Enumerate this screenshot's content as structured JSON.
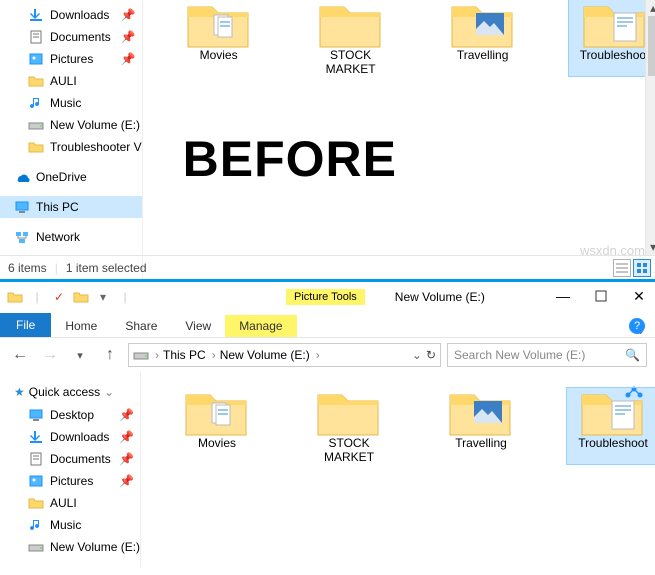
{
  "top": {
    "nav": [
      {
        "icon": "downloads",
        "label": "Downloads",
        "pin": true
      },
      {
        "icon": "documents",
        "label": "Documents",
        "pin": true
      },
      {
        "icon": "pictures",
        "label": "Pictures",
        "pin": true
      },
      {
        "icon": "folder",
        "label": "AULI",
        "pin": false
      },
      {
        "icon": "music",
        "label": "Music",
        "pin": false
      },
      {
        "icon": "drive",
        "label": "New Volume (E:)",
        "pin": false
      },
      {
        "icon": "folder",
        "label": "Troubleshooter V",
        "pin": false
      }
    ],
    "onedrive": "OneDrive",
    "thispc": "This PC",
    "network": "Network",
    "status_items": "6 items",
    "status_selected": "1 item selected",
    "folders": [
      {
        "label": "Movies",
        "type": "files"
      },
      {
        "label": "STOCK MARKET",
        "type": "plain"
      },
      {
        "label": "Travelling",
        "type": "photo"
      },
      {
        "label": "Troubleshoot",
        "type": "doc",
        "selected": true
      }
    ],
    "before": "BEFORE"
  },
  "bottom": {
    "pictools": "Picture Tools",
    "title": "New Volume (E:)",
    "tabs": {
      "file": "File",
      "home": "Home",
      "share": "Share",
      "view": "View",
      "manage": "Manage"
    },
    "breadcrumb": [
      "This PC",
      "New Volume (E:)"
    ],
    "search_placeholder": "Search New Volume (E:)",
    "quick": "Quick access",
    "nav": [
      {
        "icon": "desktop",
        "label": "Desktop",
        "pin": true
      },
      {
        "icon": "downloads",
        "label": "Downloads",
        "pin": true
      },
      {
        "icon": "documents",
        "label": "Documents",
        "pin": true
      },
      {
        "icon": "pictures",
        "label": "Pictures",
        "pin": true
      },
      {
        "icon": "folder",
        "label": "AULI",
        "pin": false
      },
      {
        "icon": "music",
        "label": "Music",
        "pin": false
      },
      {
        "icon": "drive",
        "label": "New Volume (E:)",
        "pin": false
      }
    ],
    "folders": [
      {
        "label": "Movies",
        "type": "files"
      },
      {
        "label": "STOCK MARKET",
        "type": "plain"
      },
      {
        "label": "Travelling",
        "type": "photo"
      },
      {
        "label": "Troubleshoot",
        "type": "doc",
        "selected": true,
        "share": true
      }
    ]
  },
  "watermark": "wsxdn.com"
}
